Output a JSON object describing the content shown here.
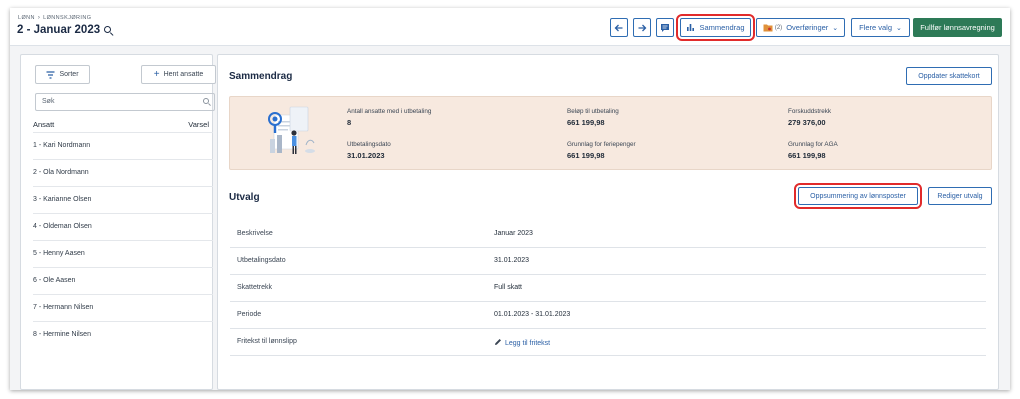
{
  "header": {
    "breadcrumb_root": "LØNN",
    "breadcrumb_leaf": "LØNNSKJØRING",
    "title": "2 - Januar 2023",
    "sammendrag_label": "Sammendrag",
    "overforinger_count": "(2)",
    "overforinger_label": "Overføringer",
    "flere_valg_label": "Flere valg",
    "fullfor_label": "Fullfør lønnsavregning"
  },
  "sidebar": {
    "sort_label": "Sorter",
    "fetch_label": "Hent ansatte",
    "search_placeholder": "Søk",
    "col_employee": "Ansatt",
    "col_warning": "Varsel",
    "employees": [
      "1 - Kari Nordmann",
      "2 - Ola Nordmann",
      "3 - Karianne Olsen",
      "4 - Oldeman Olsen",
      "5 - Henny Aasen",
      "6 - Ole Aasen",
      "7 - Hermann Nilsen",
      "8 - Hermine Nilsen"
    ]
  },
  "summary": {
    "heading": "Sammendrag",
    "update_tax_card_label": "Oppdater skattekort",
    "stats": [
      {
        "label": "Antall ansatte med i utbetaling",
        "value": "8"
      },
      {
        "label": "Beløp til utbetaling",
        "value": "661 199,98"
      },
      {
        "label": "Forskuddstrekk",
        "value": "279 376,00"
      },
      {
        "label": "Utbetalingsdato",
        "value": "31.01.2023"
      },
      {
        "label": "Grunnlag for feriepenger",
        "value": "661 199,98"
      },
      {
        "label": "Grunnlag for AGA",
        "value": "661 199,98"
      }
    ]
  },
  "selection": {
    "heading": "Utvalg",
    "summary_button_label": "Oppsummering av lønnsposter",
    "edit_button_label": "Rediger utvalg",
    "rows": [
      {
        "key": "Beskrivelse",
        "value": "Januar 2023"
      },
      {
        "key": "Utbetalingsdato",
        "value": "31.01.2023"
      },
      {
        "key": "Skattetrekk",
        "value": "Full skatt"
      },
      {
        "key": "Periode",
        "value": "01.01.2023 - 31.01.2023"
      },
      {
        "key": "Fritekst til lønnslipp",
        "value": "Legg til fritekst"
      }
    ]
  },
  "colors": {
    "accent": "#2a5fa5",
    "primary": "#2d7a57",
    "highlight": "#e12b2b",
    "summary_bg": "#f7e9df"
  }
}
